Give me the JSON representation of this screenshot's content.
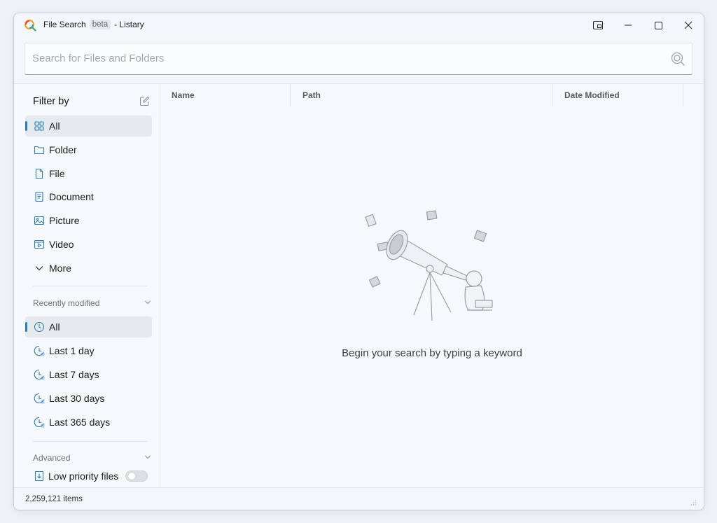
{
  "window": {
    "title": "File Search",
    "badge": "beta",
    "app_suffix": "- Listary",
    "controls": [
      "restore-icon",
      "minimize-icon",
      "maximize-icon",
      "close-icon"
    ]
  },
  "search": {
    "placeholder": "Search for Files and Folders",
    "value": ""
  },
  "sidebar": {
    "filter_heading": "Filter by",
    "filters": [
      {
        "label": "All",
        "icon": "grid-icon",
        "active": true
      },
      {
        "label": "Folder",
        "icon": "folder-icon"
      },
      {
        "label": "File",
        "icon": "file-icon"
      },
      {
        "label": "Document",
        "icon": "document-icon"
      },
      {
        "label": "Picture",
        "icon": "picture-icon"
      },
      {
        "label": "Video",
        "icon": "video-icon"
      },
      {
        "label": "More",
        "icon": "chevron-down-icon"
      }
    ],
    "recent_heading": "Recently modified",
    "recent": [
      {
        "label": "All",
        "icon": "clock-icon",
        "active": true
      },
      {
        "label": "Last 1 day",
        "icon": "clock-icon"
      },
      {
        "label": "Last 7 days",
        "icon": "clock-icon"
      },
      {
        "label": "Last 30 days",
        "icon": "clock-icon"
      },
      {
        "label": "Last 365 days",
        "icon": "clock-icon"
      }
    ],
    "advanced_heading": "Advanced",
    "low_priority_label": "Low priority files",
    "low_priority_enabled": false
  },
  "table": {
    "columns": [
      "Name",
      "Path",
      "Date Modified"
    ]
  },
  "empty_state": {
    "message": "Begin your search by typing a keyword"
  },
  "status": {
    "item_count": "2,259,121 items"
  },
  "colors": {
    "accent": "#2a7fb8",
    "background": "#f3f6fa"
  }
}
